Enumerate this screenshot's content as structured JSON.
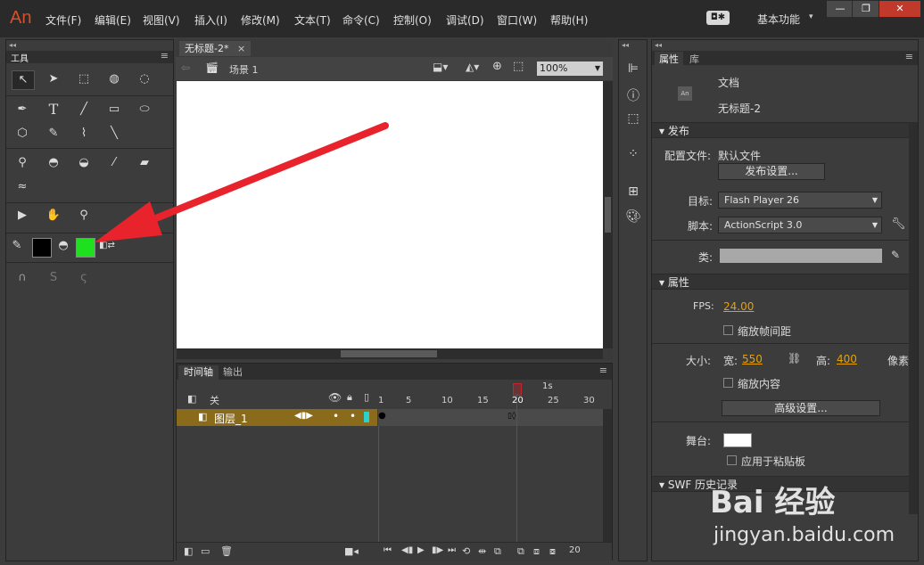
{
  "app": {
    "logo": "An"
  },
  "menu": [
    "文件(F)",
    "编辑(E)",
    "视图(V)",
    "插入(I)",
    "修改(M)",
    "文本(T)",
    "命令(C)",
    "控制(O)",
    "调试(D)",
    "窗口(W)",
    "帮助(H)"
  ],
  "workspace": {
    "label": "基本功能",
    "caret": "▾"
  },
  "window_buttons": {
    "minimize": "—",
    "restore": "❐",
    "close": "✕"
  },
  "tools_panel": {
    "title": "工具"
  },
  "document": {
    "tab_title": "无标题-2*",
    "tab_close": "×",
    "scene_label": "场景 1",
    "zoom": "100%"
  },
  "timeline": {
    "tabs": [
      "时间轴",
      "输出"
    ],
    "header_label": "关",
    "layer_name": "图层_1",
    "seconds_marker": "1s",
    "frame_numbers": [
      "1",
      "5",
      "10",
      "15",
      "20",
      "25",
      "30"
    ],
    "current_frame": "20",
    "footer_counter": "20"
  },
  "properties": {
    "tabs": [
      "属性",
      "库"
    ],
    "doc_label": "文档",
    "doc_name": "无标题-2",
    "doc_icon": "An",
    "publish_header": "发布",
    "profile_label": "配置文件:",
    "profile_value": "默认文件",
    "publish_settings_btn": "发布设置...",
    "target_label": "目标:",
    "target_value": "Flash Player 26",
    "script_label": "脚本:",
    "script_value": "ActionScript 3.0",
    "class_label": "类:",
    "props_header": "属性",
    "fps_label": "FPS:",
    "fps_value": "24.00",
    "scale_spans_label": "缩放帧间距",
    "size_label": "大小:",
    "width_label": "宽:",
    "width_value": "550",
    "height_label": "高:",
    "height_value": "400",
    "units_label": "像素",
    "scale_content_label": "缩放内容",
    "advanced_btn": "高级设置...",
    "stage_label": "舞台:",
    "clipboard_label": "应用于粘贴板",
    "swf_header": "SWF 历史记录"
  },
  "colors": {
    "stroke": "#000000",
    "fill": "#1ee01e",
    "arrow": "#e8232b",
    "playhead": "#c0262b",
    "layer_row": "#8a6b1c",
    "accent_value": "#e8a000"
  },
  "watermark": {
    "brand": "Bai 经验",
    "url": "jingyan.baidu.com"
  }
}
